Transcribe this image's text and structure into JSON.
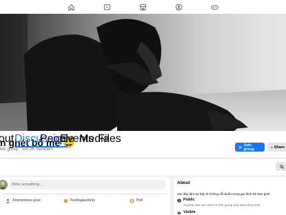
{
  "nav": {
    "icons": [
      "home-icon",
      "video-icon",
      "marketplace-icon",
      "groups-icon",
      "gaming-icon"
    ]
  },
  "group": {
    "name": "n ghét bố mẹ 😀",
    "meta": "blic group · 100.0K members"
  },
  "buttons": {
    "join": "Join group",
    "share": "Share"
  },
  "tabs": [
    {
      "label": "out"
    },
    {
      "label": "Discussion"
    },
    {
      "label": "People"
    },
    {
      "label": "Events"
    },
    {
      "label": "Media"
    },
    {
      "label": "Files"
    }
  ],
  "composer": {
    "placeholder": "Write something...",
    "actions": [
      {
        "label": "Anonymous post",
        "icon": "anonymous-icon",
        "color": "#1877f2"
      },
      {
        "label": "Feeling/activity",
        "icon": "feeling-icon",
        "color": "#f7b928"
      },
      {
        "label": "Poll",
        "icon": "poll-icon",
        "color": "#e4a11b"
      }
    ]
  },
  "about": {
    "title": "About",
    "description": "vào đây tâm sự bày tỏ những nỗi buồn trong gia đình khi bạn ghét",
    "public_title": "Public",
    "public_sub": "Anyone can see who's in the group and what they post.",
    "visible_title": "Visible"
  },
  "colors": {
    "accent": "#1877f2",
    "background": "#f0f2f5"
  }
}
